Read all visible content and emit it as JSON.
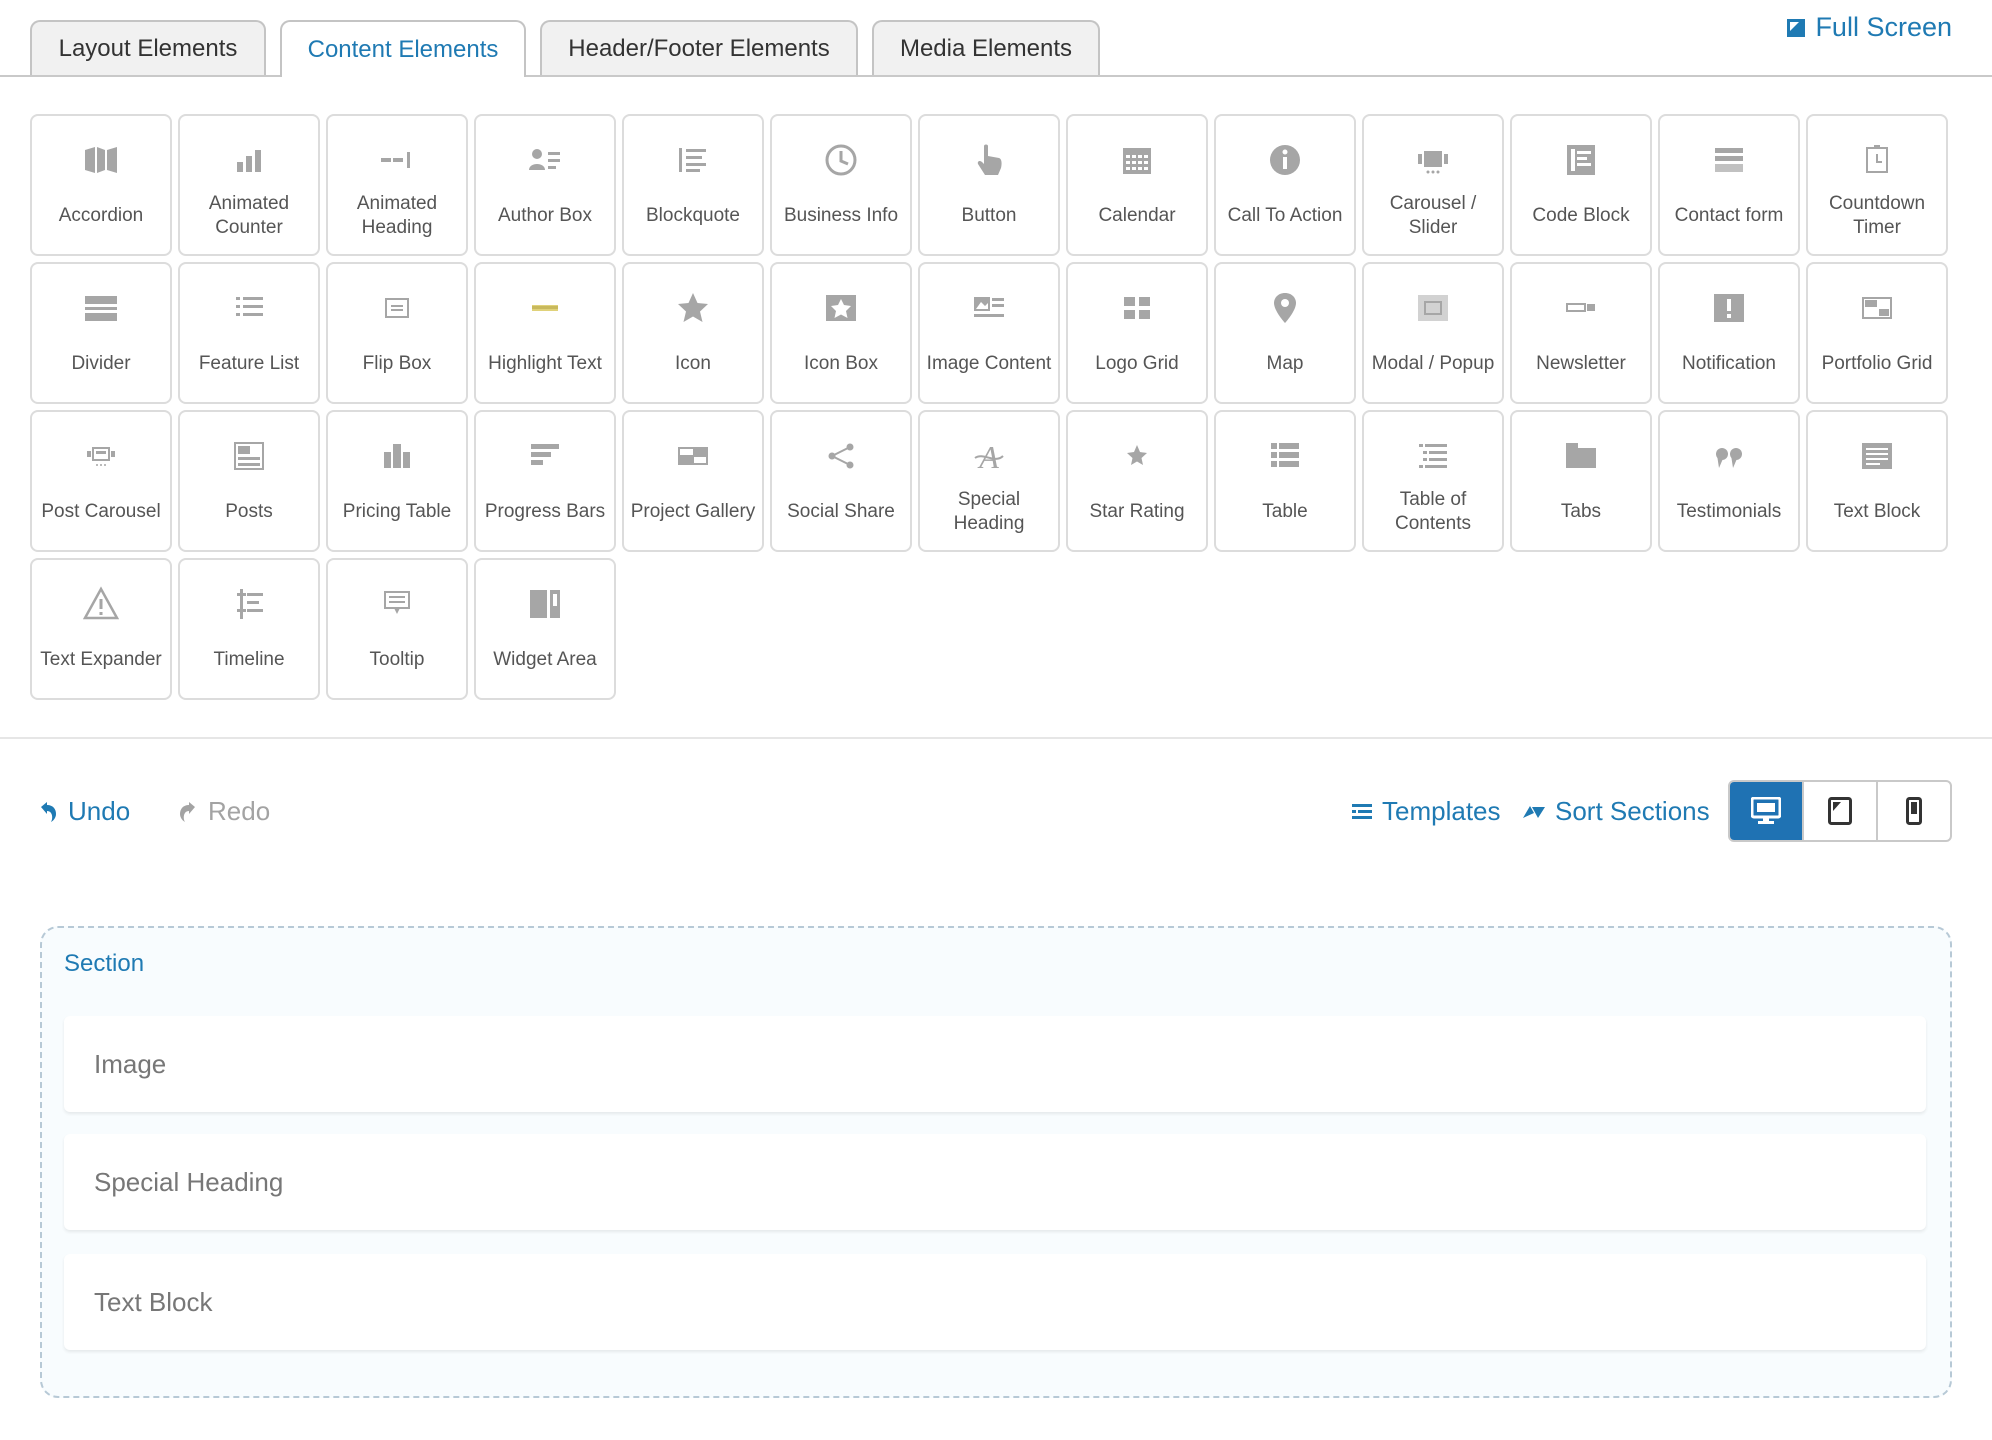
{
  "tabs": [
    {
      "label": "Layout Elements",
      "active": false
    },
    {
      "label": "Content Elements",
      "active": true
    },
    {
      "label": "Header/Footer Elements",
      "active": false
    },
    {
      "label": "Media Elements",
      "active": false
    }
  ],
  "fullscreen_label": "Full Screen",
  "elements": [
    {
      "label": "Accordion",
      "icon": "accordion-icon"
    },
    {
      "label": "Animated Counter",
      "icon": "counter-icon"
    },
    {
      "label": "Animated Heading",
      "icon": "animated-heading-icon"
    },
    {
      "label": "Author Box",
      "icon": "author-icon"
    },
    {
      "label": "Blockquote",
      "icon": "blockquote-icon"
    },
    {
      "label": "Business Info",
      "icon": "clock-icon"
    },
    {
      "label": "Button",
      "icon": "pointer-icon"
    },
    {
      "label": "Calendar",
      "icon": "calendar-icon"
    },
    {
      "label": "Call To Action",
      "icon": "info-icon"
    },
    {
      "label": "Carousel / Slider",
      "icon": "carousel-icon"
    },
    {
      "label": "Code Block",
      "icon": "code-block-icon"
    },
    {
      "label": "Contact form",
      "icon": "form-icon"
    },
    {
      "label": "Countdown Timer",
      "icon": "timer-icon"
    },
    {
      "label": "Divider",
      "icon": "divider-icon"
    },
    {
      "label": "Feature List",
      "icon": "list-icon"
    },
    {
      "label": "Flip Box",
      "icon": "flip-box-icon"
    },
    {
      "label": "Highlight Text",
      "icon": "highlight-icon"
    },
    {
      "label": "Icon",
      "icon": "star-icon"
    },
    {
      "label": "Icon Box",
      "icon": "star-box-icon"
    },
    {
      "label": "Image Content",
      "icon": "image-content-icon"
    },
    {
      "label": "Logo Grid",
      "icon": "grid-icon"
    },
    {
      "label": "Map",
      "icon": "map-pin-icon"
    },
    {
      "label": "Modal / Popup",
      "icon": "modal-icon"
    },
    {
      "label": "Newsletter",
      "icon": "newsletter-icon"
    },
    {
      "label": "Notification",
      "icon": "notification-icon"
    },
    {
      "label": "Portfolio Grid",
      "icon": "portfolio-icon"
    },
    {
      "label": "Post Carousel",
      "icon": "post-carousel-icon"
    },
    {
      "label": "Posts",
      "icon": "posts-icon"
    },
    {
      "label": "Pricing Table",
      "icon": "pricing-icon"
    },
    {
      "label": "Progress Bars",
      "icon": "progress-bars-icon"
    },
    {
      "label": "Project Gallery",
      "icon": "gallery-icon"
    },
    {
      "label": "Social Share",
      "icon": "share-icon"
    },
    {
      "label": "Special Heading",
      "icon": "special-heading-icon"
    },
    {
      "label": "Star Rating",
      "icon": "star-rating-icon"
    },
    {
      "label": "Table",
      "icon": "table-icon"
    },
    {
      "label": "Table of Contents",
      "icon": "toc-icon"
    },
    {
      "label": "Tabs",
      "icon": "tabs-icon"
    },
    {
      "label": "Testimonials",
      "icon": "quote-icon"
    },
    {
      "label": "Text Block",
      "icon": "text-block-icon"
    },
    {
      "label": "Text Expander",
      "icon": "warning-icon"
    },
    {
      "label": "Timeline",
      "icon": "timeline-icon"
    },
    {
      "label": "Tooltip",
      "icon": "tooltip-icon"
    },
    {
      "label": "Widget Area",
      "icon": "widget-icon"
    }
  ],
  "toolbar": {
    "undo": "Undo",
    "redo": "Redo",
    "templates": "Templates",
    "sort_sections": "Sort Sections",
    "devices": [
      "desktop",
      "tablet",
      "mobile"
    ],
    "active_device": "desktop"
  },
  "section": {
    "title": "Section",
    "blocks": [
      "Image",
      "Special Heading",
      "Text Block"
    ]
  },
  "colors": {
    "accent": "#1f7ab3",
    "active_device_bg": "#1f72b3",
    "icon_gray": "#a6a6a6",
    "highlight": "#e0d27a"
  }
}
